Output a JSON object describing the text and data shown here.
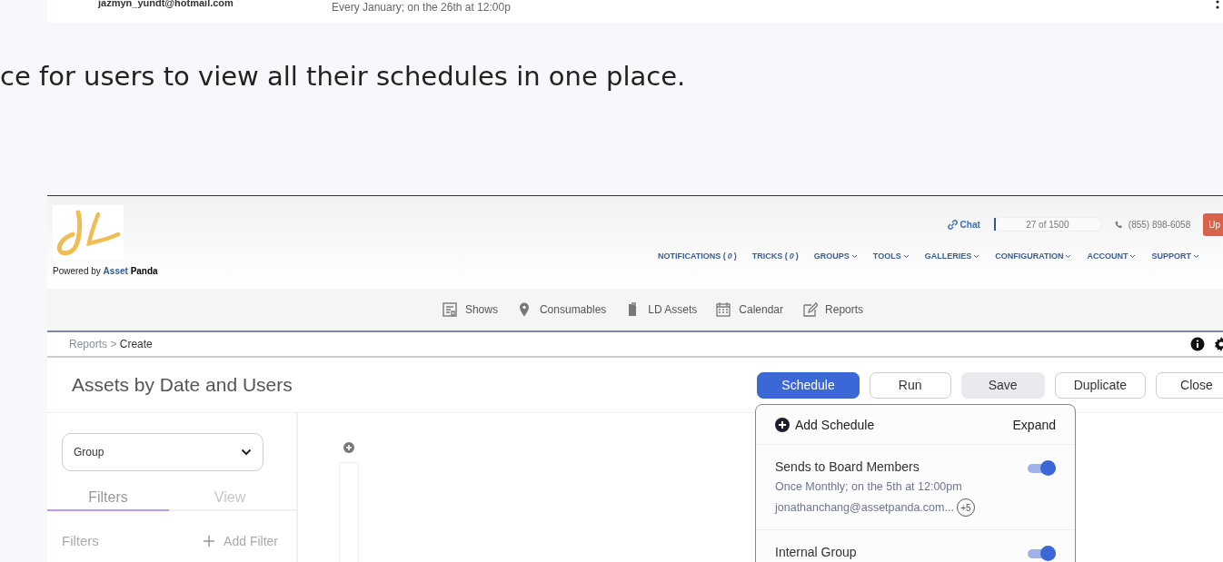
{
  "top_card": {
    "email": "jazmyn_yundt@hotmail.com",
    "schedule": "Every January; on the 26th at 12:00p"
  },
  "intro_text": "ce for users to view all their schedules in one place.",
  "app": {
    "logo_caption": {
      "prefix": "Powered by",
      "brand_first": "Asset",
      "brand_second": "Panda"
    },
    "chat": "Chat",
    "usage": {
      "text": "27 of 1500",
      "level": 0.02
    },
    "phone": "(855) 898-6058",
    "upgrade_button": "Up",
    "nav": [
      {
        "label": "NOTIFICATIONS ( *0* )",
        "dropdown": false
      },
      {
        "label": "TRICKS ( *0* )",
        "dropdown": false
      },
      {
        "label": "GROUPS",
        "dropdown": true
      },
      {
        "label": "TOOLS",
        "dropdown": true
      },
      {
        "label": "GALLERIES",
        "dropdown": true
      },
      {
        "label": "CONFIGURATION",
        "dropdown": true
      },
      {
        "label": "ACCOUNT",
        "dropdown": true
      },
      {
        "label": "SUPPORT",
        "dropdown": true
      }
    ],
    "subnav": [
      {
        "label": "Shows"
      },
      {
        "label": "Consumables"
      },
      {
        "label": "LD Assets"
      },
      {
        "label": "Calendar"
      },
      {
        "label": "Reports"
      }
    ],
    "breadcrumb": {
      "parent": "Reports",
      "separator": ">",
      "current": "Create"
    },
    "title": "Assets by Date and Users",
    "buttons": [
      {
        "label": "Schedule",
        "kind": "primary"
      },
      {
        "label": "Run",
        "kind": "outline"
      },
      {
        "label": "Save",
        "kind": "muted"
      },
      {
        "label": "Duplicate",
        "kind": "outline"
      },
      {
        "label": "Close",
        "kind": "outline"
      }
    ],
    "sidebar": {
      "group_select": "Group",
      "tabs": [
        {
          "label": "Filters",
          "selected": true
        },
        {
          "label": "View",
          "selected": false
        }
      ],
      "filters_label": "Filters",
      "add_filter": "Add Filter"
    },
    "schedule_menu": {
      "add": "Add Schedule",
      "expand": "Expand",
      "items": [
        {
          "name": "Sends to Board Members",
          "frequency": "Once Monthly; on the 5th at 12:00pm",
          "recipients": "jonathanchang@assetpanda.com...",
          "extra": "+5",
          "on": true
        },
        {
          "name": "Internal Group",
          "on": true
        }
      ]
    }
  }
}
